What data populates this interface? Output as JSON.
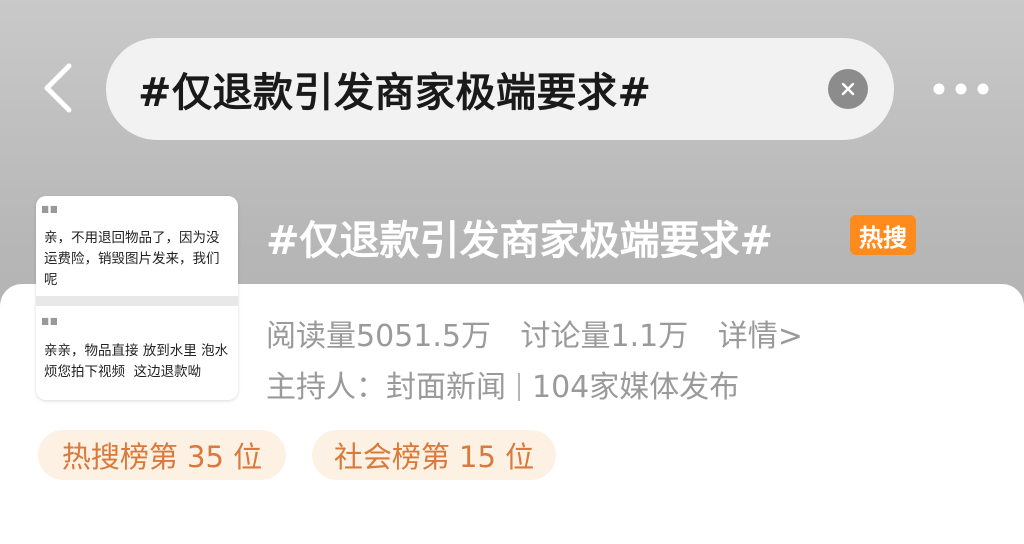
{
  "header": {
    "search_query": "#仅退款引发商家极端要求#",
    "back_icon": "chevron-left-icon",
    "clear_icon": "close-circle-icon",
    "more_icon": "more-dots-icon"
  },
  "topic": {
    "title": "#仅退款引发商家极端要求#",
    "hot_badge": "热搜",
    "stats": {
      "reads": "阅读量5051.5万",
      "discussions": "讨论量1.1万",
      "details": "详情>"
    },
    "host_label": "主持人：封面新闻",
    "media_count": "104家媒体发布",
    "thumbnail": {
      "message_1": "亲，不用退回物品了，因为没\n运费险，销毁图片发来，我们\n呢",
      "message_2": "亲亲，物品直接 放到水里 泡水\n烦您拍下视频  这边退款呦"
    },
    "ranks": [
      {
        "label": "热搜榜第 35 位"
      },
      {
        "label": "社会榜第 15 位"
      }
    ]
  },
  "colors": {
    "badge": "#ff8a1e",
    "chip_bg": "#fdf1e4",
    "chip_text": "#d9793a"
  }
}
